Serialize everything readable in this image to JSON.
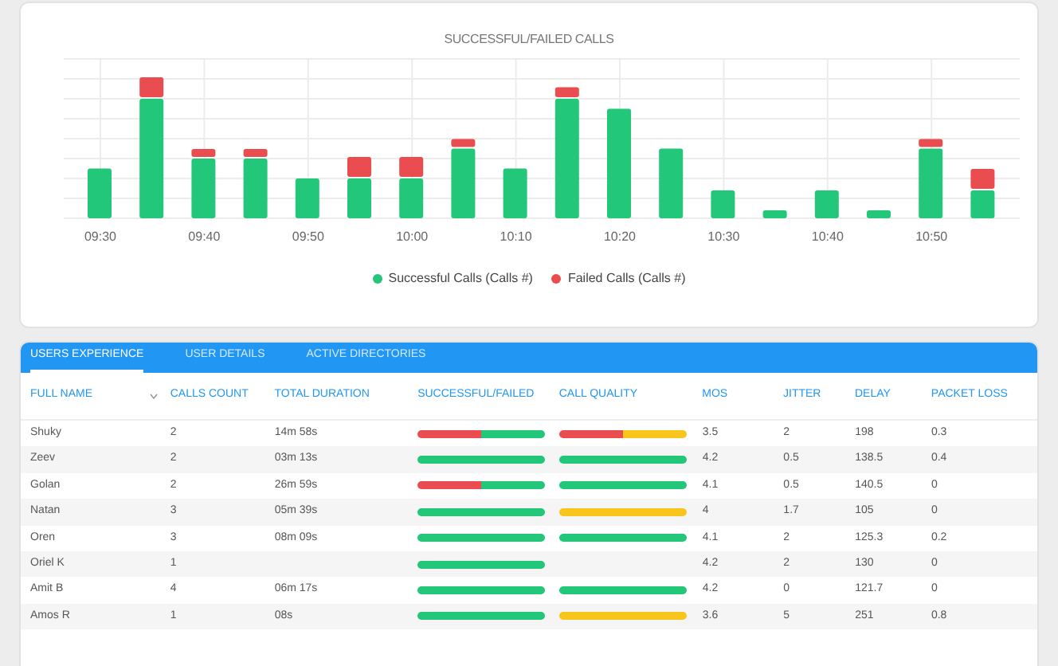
{
  "chart": {
    "title": "SUCCESSFUL/FAILED CALLS",
    "x_labels": [
      "09:30",
      "09:40",
      "09:50",
      "10:00",
      "10:10",
      "10:20",
      "10:30",
      "10:40",
      "10:50"
    ],
    "legend": [
      {
        "label": "Successful Calls (Calls #)",
        "color": "#22c77a"
      },
      {
        "label": "Failed Calls (Calls #)",
        "color": "#ea4d4f"
      }
    ]
  },
  "tabs": [
    {
      "label": "USERS EXPERIENCE",
      "selected": true
    },
    {
      "label": "USER DETAILS",
      "selected": false
    },
    {
      "label": "ACTIVE DIRECTORIES",
      "selected": false
    }
  ],
  "table": {
    "columns": [
      "FULL NAME",
      "CALLS COUNT",
      "TOTAL DURATION",
      "SUCCESSFUL/FAILED",
      "CALL QUALITY",
      "MOS",
      "JITTER",
      "DELAY",
      "PACKET LOSS"
    ],
    "rows": [
      {
        "name": "Shuky",
        "calls": "2",
        "duration": "14m 58s",
        "success": {
          "kind": "mixed"
        },
        "quality": {
          "kind": "mixed"
        },
        "mos": "3.5",
        "jitter": "2",
        "delay": "198",
        "loss": "0.3"
      },
      {
        "name": "Zeev",
        "calls": "2",
        "duration": "03m 13s",
        "success": {
          "kind": "good"
        },
        "quality": {
          "kind": "good"
        },
        "mos": "4.2",
        "jitter": "0.5",
        "delay": "138.5",
        "loss": "0.4"
      },
      {
        "name": "Golan",
        "calls": "2",
        "duration": "26m 59s",
        "success": {
          "kind": "mixed"
        },
        "quality": {
          "kind": "good"
        },
        "mos": "4.1",
        "jitter": "0.5",
        "delay": "140.5",
        "loss": "0"
      },
      {
        "name": "Natan",
        "calls": "3",
        "duration": "05m 39s",
        "success": {
          "kind": "good"
        },
        "quality": {
          "kind": "fair"
        },
        "mos": "4",
        "jitter": "1.7",
        "delay": "105",
        "loss": "0"
      },
      {
        "name": "Oren",
        "calls": "3",
        "duration": "08m 09s",
        "success": {
          "kind": "good"
        },
        "quality": {
          "kind": "good"
        },
        "mos": "4.1",
        "jitter": "2",
        "delay": "125.3",
        "loss": "0.2"
      },
      {
        "name": "Oriel K",
        "calls": "1",
        "success": {
          "kind": "good"
        },
        "mos": "4.2",
        "jitter": "2",
        "delay": "130",
        "loss": "0"
      },
      {
        "name": "Amit B",
        "calls": "4",
        "duration": "06m 17s",
        "success": {
          "kind": "good"
        },
        "quality": {
          "kind": "good"
        },
        "mos": "4.2",
        "jitter": "0",
        "delay": "121.7",
        "loss": "0"
      },
      {
        "name": "Amos R",
        "calls": "1",
        "duration": "08s",
        "success": {
          "kind": "good"
        },
        "quality": {
          "kind": "fair"
        },
        "mos": "3.6",
        "jitter": "5",
        "delay": "251",
        "loss": "0.8"
      }
    ]
  }
}
